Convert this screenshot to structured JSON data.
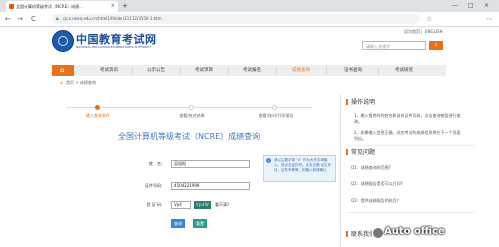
{
  "browser": {
    "tab_title": "全国计算机等级考试（NCRE）成绩...",
    "tab_close": "×",
    "new_tab": "+",
    "url": "cjcx.neea.edu.cn/html1/folder/21112/3556-1.htm",
    "lock_icon": "lock-icon",
    "win_min": "—",
    "win_max": "□",
    "win_close": "×",
    "back": "←",
    "forward": "→",
    "reload": "C",
    "star": "☆",
    "menu": "⋯"
  },
  "header": {
    "logo_cn": "中国教育考试网",
    "logo_en": "NATIONAL EDUCATION EXAMINATIONS AUTHORITY",
    "links": [
      "设为首页",
      "|",
      "ENGLISH"
    ],
    "search_placeholder": "请输入关键字",
    "search_button": "⌕"
  },
  "nav": {
    "home_icon": "⌂",
    "items": [
      "考试资讯",
      "公示公告",
      "考试项目",
      "考试报名",
      "成绩查询",
      "证书查询",
      "考试研究"
    ],
    "active_index": 4
  },
  "breadcrumb": {
    "text": "首页 > 成绩查询"
  },
  "steps": [
    "输入查询条件",
    "查看/核对结果",
    "查看/核对/打印报告"
  ],
  "page_title": "全国计算机等级考试（NCRE）成绩查询",
  "form": {
    "name_label": "姓　名：",
    "name_value": "吴旭阳",
    "id_label": "证件号码：",
    "id_value": "4504221999",
    "captcha_label": "验 证 码：",
    "captcha_input": "Vp4",
    "captcha_image": "Vp4W",
    "refresh_link": "看不清?",
    "hint": "请以主要字母 \"X\" 作为大写字母输入，请点击证件号，点击正确 出生年月，证件号等等，如输入前请确认",
    "query_button": "查询",
    "reset_button": "重置"
  },
  "sidebar": {
    "help_title": "操作说明",
    "help_items": [
      "1、输入报考时的姓名和身份证件号码，点击查询按钮进行查询。",
      "2、如果输入信息正确，对应考试的成绩信息将在下一个页面列出。"
    ],
    "faq_title": "常见问题",
    "faq_items": [
      "Q1：成绩查询的范围?",
      "Q2：成绩报告是否可以打印?",
      "Q3：提供成绩报告的科目?"
    ],
    "contact_title": "联系我们"
  },
  "watermark": "Auto office",
  "colors": {
    "accent": "#e8721a",
    "brand_blue": "#1a4e9a",
    "title_blue": "#3f76c4",
    "query_btn": "#3a86d6",
    "reset_btn": "#2f9a8a"
  }
}
